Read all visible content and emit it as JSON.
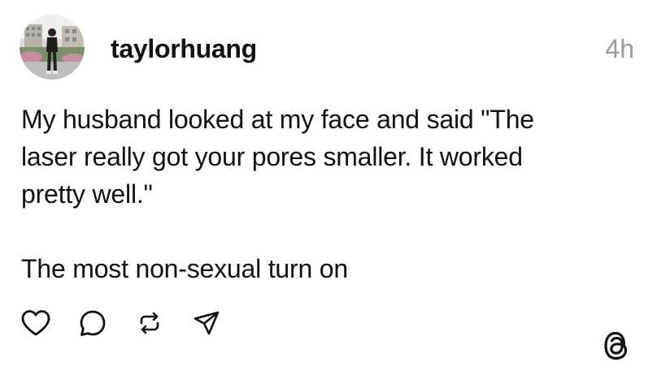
{
  "post": {
    "username": "taylorhuang",
    "timestamp": "4h",
    "body": {
      "line1": "My husband looked at my face and said \"The",
      "line2": "laser really got your pores smaller. It worked",
      "line3": "pretty well.\"",
      "line4": "The most non-sexual turn on"
    },
    "actions": {
      "like_icon": "heart-icon",
      "reply_icon": "comment-icon",
      "repost_icon": "repost-icon",
      "share_icon": "send-icon"
    },
    "brand_icon": "threads-logo-icon"
  },
  "colors": {
    "text": "#111111",
    "muted": "#9a9a9a",
    "background": "#ffffff"
  }
}
